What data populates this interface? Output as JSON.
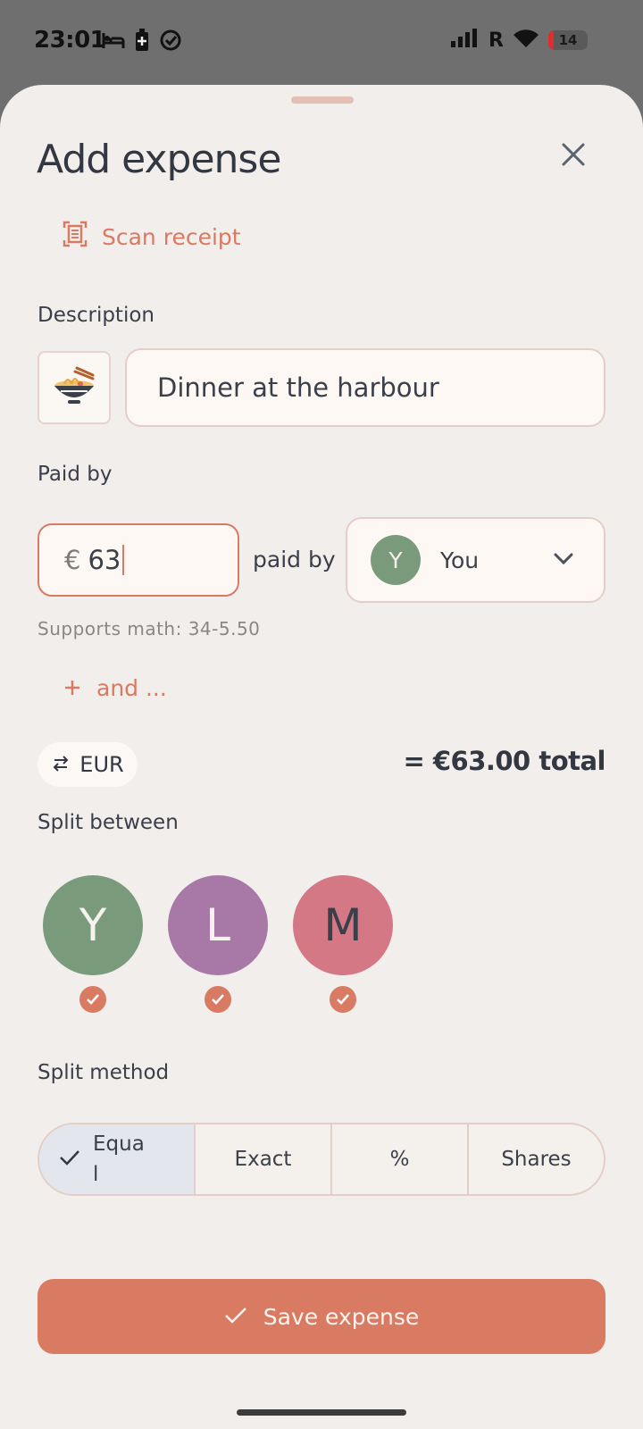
{
  "status_bar": {
    "time": "23:01",
    "carrier_indicator": "R",
    "battery_level": "14"
  },
  "sheet": {
    "title": "Add expense",
    "scan_receipt_label": "Scan receipt",
    "description": {
      "label": "Description",
      "emoji": "🍜",
      "value": "Dinner at the harbour"
    },
    "paid_by": {
      "label": "Paid by",
      "currency_symbol": "€",
      "amount_value": "63",
      "paid_by_text": "paid by",
      "payer": {
        "initial": "Y",
        "name": "You"
      },
      "hint": "Supports math: 34-5.50",
      "and_label": "and ..."
    },
    "currency": {
      "code": "EUR"
    },
    "total_text": "= €63.00 total",
    "split_between": {
      "label": "Split between",
      "members": [
        {
          "initial": "Y",
          "color": "#7a9a7c",
          "selected": true
        },
        {
          "initial": "L",
          "color": "#a879a6",
          "selected": true
        },
        {
          "initial": "M",
          "color": "#d47885",
          "selected": true
        }
      ]
    },
    "split_method": {
      "label": "Split method",
      "options": [
        "Equal",
        "Exact",
        "%",
        "Shares"
      ],
      "selected": "Equal"
    },
    "save_label": "Save expense"
  },
  "colors": {
    "accent": "#d97a62",
    "sheet_bg": "#f2eeeb",
    "text": "#323742"
  }
}
